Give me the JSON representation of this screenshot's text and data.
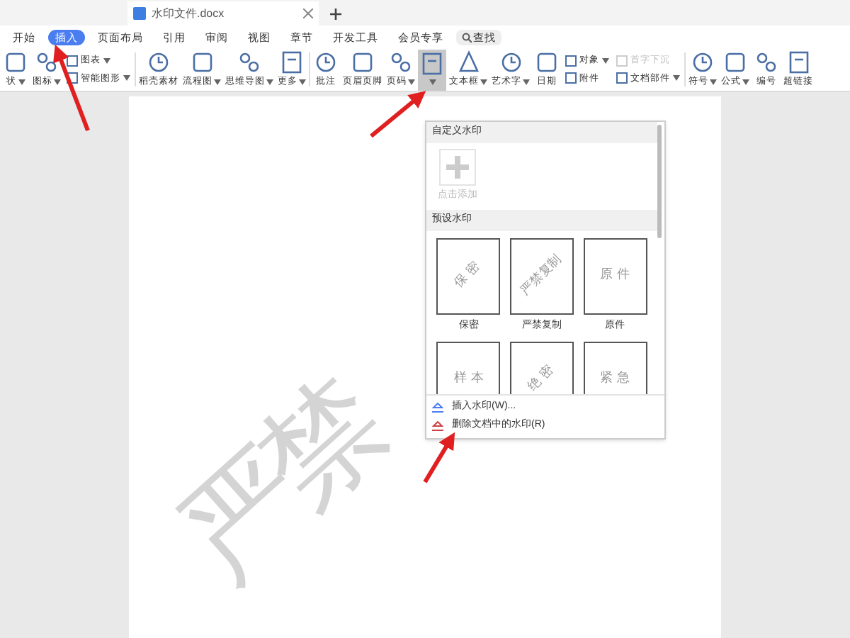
{
  "doc_tab": {
    "title": "水印文件.docx"
  },
  "menu": [
    {
      "label": "开始",
      "selected": false
    },
    {
      "label": "插入",
      "selected": true
    },
    {
      "label": "页面布局",
      "selected": false
    },
    {
      "label": "引用",
      "selected": false
    },
    {
      "label": "审阅",
      "selected": false
    },
    {
      "label": "视图",
      "selected": false
    },
    {
      "label": "章节",
      "selected": false
    },
    {
      "label": "开发工具",
      "selected": false
    },
    {
      "label": "会员专享",
      "selected": false
    }
  ],
  "search": {
    "label": "查找"
  },
  "ribbon": [
    {
      "kind": "large",
      "label": "状",
      "dropdown": true,
      "pressed": false
    },
    {
      "kind": "large",
      "label": "图标",
      "dropdown": true,
      "pressed": false
    },
    {
      "kind": "stack",
      "items": [
        {
          "label": "图表",
          "dropdown": true,
          "disabled": false
        },
        {
          "label": "智能图形",
          "dropdown": true,
          "disabled": false
        }
      ]
    },
    {
      "kind": "sep"
    },
    {
      "kind": "large",
      "label": "稻壳素材",
      "dropdown": false,
      "pressed": false
    },
    {
      "kind": "large",
      "label": "流程图",
      "dropdown": true,
      "pressed": false
    },
    {
      "kind": "large",
      "label": "思维导图",
      "dropdown": true,
      "pressed": false
    },
    {
      "kind": "large",
      "label": "更多",
      "dropdown": true,
      "pressed": false
    },
    {
      "kind": "sep"
    },
    {
      "kind": "large",
      "label": "批注",
      "dropdown": false,
      "pressed": false
    },
    {
      "kind": "large",
      "label": "页眉页脚",
      "dropdown": false,
      "pressed": false
    },
    {
      "kind": "large",
      "label": "页码",
      "dropdown": true,
      "pressed": false
    },
    {
      "kind": "large",
      "dropdown": true,
      "pressed": true
    },
    {
      "kind": "large",
      "label": "文本框",
      "dropdown": true,
      "pressed": false
    },
    {
      "kind": "large",
      "label": "艺术字",
      "dropdown": true,
      "pressed": false
    },
    {
      "kind": "large",
      "label": "日期",
      "dropdown": false,
      "pressed": false
    },
    {
      "kind": "stack",
      "items": [
        {
          "label": "对象",
          "dropdown": true,
          "disabled": false
        },
        {
          "label": "附件",
          "dropdown": false,
          "disabled": false
        }
      ]
    },
    {
      "kind": "stack",
      "items": [
        {
          "label": "首字下沉",
          "dropdown": false,
          "disabled": true
        },
        {
          "label": "文档部件",
          "dropdown": true,
          "disabled": false
        }
      ]
    },
    {
      "kind": "sep"
    },
    {
      "kind": "large",
      "label": "符号",
      "dropdown": true,
      "pressed": false
    },
    {
      "kind": "large",
      "label": "公式",
      "dropdown": true,
      "pressed": false
    },
    {
      "kind": "large",
      "label": "编号",
      "dropdown": false,
      "pressed": false
    },
    {
      "kind": "large",
      "label": "超链接",
      "dropdown": false,
      "pressed": false
    }
  ],
  "watermark_menu": {
    "custom_header": "自定义水印",
    "add_label": "点击添加",
    "preset_header": "预设水印",
    "presets": [
      {
        "text": "保 密",
        "label": "保密",
        "rotated": true
      },
      {
        "text": "严禁复制",
        "label": "严禁复制",
        "rotated": true
      },
      {
        "text": "原 件",
        "label": "原件",
        "rotated": false
      },
      {
        "text": "样 本",
        "rotated": false
      },
      {
        "text": "绝 密",
        "rotated": true
      },
      {
        "text": "紧 急",
        "rotated": false
      }
    ],
    "actions": [
      {
        "label": "插入水印(W)..."
      },
      {
        "label": "删除文档中的水印(R)"
      }
    ]
  },
  "document": {
    "watermark": "严禁"
  }
}
